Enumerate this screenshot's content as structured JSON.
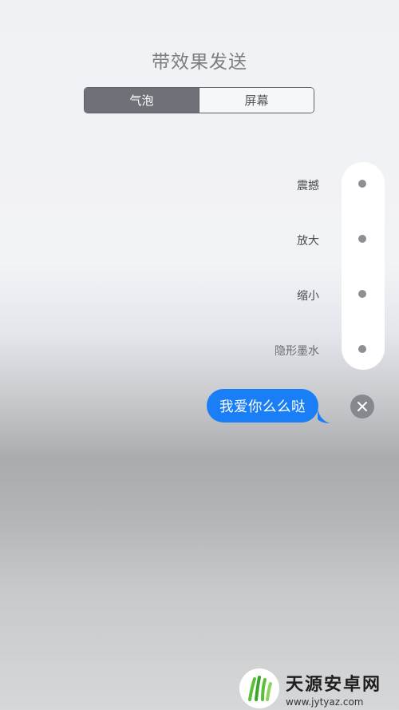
{
  "header": {
    "title": "带效果发送"
  },
  "segmented": {
    "bubble_label": "气泡",
    "screen_label": "屏幕",
    "selected": "气泡"
  },
  "effects": [
    {
      "label": "震撼"
    },
    {
      "label": "放大"
    },
    {
      "label": "缩小"
    },
    {
      "label": "隐形墨水"
    }
  ],
  "message": {
    "text": "我爱你么么哒"
  },
  "colors": {
    "bubble": "#1a7ff6",
    "track": "#ffffff",
    "segment_active": "#6e7177"
  },
  "watermark": {
    "name": "天源安卓网",
    "url": "www.jytyaz.com"
  }
}
